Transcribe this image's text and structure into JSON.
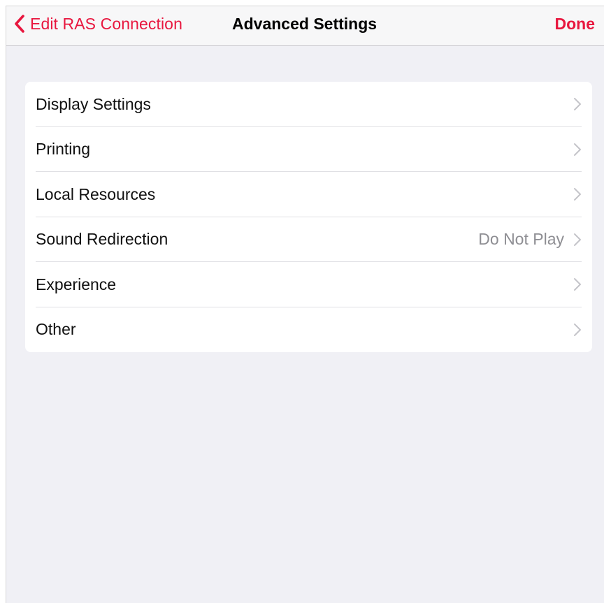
{
  "colors": {
    "accent": "#e8173f",
    "chevron": "#c4c4c9",
    "detail": "#8e8e93"
  },
  "navbar": {
    "back_label": "Edit RAS Connection",
    "back_icon": "chevron-left-icon",
    "title": "Advanced Settings",
    "done_label": "Done"
  },
  "settings": {
    "items": [
      {
        "label": "Display Settings",
        "detail": "",
        "icon": "chevron-right-icon"
      },
      {
        "label": "Printing",
        "detail": "",
        "icon": "chevron-right-icon"
      },
      {
        "label": "Local Resources",
        "detail": "",
        "icon": "chevron-right-icon"
      },
      {
        "label": "Sound Redirection",
        "detail": "Do Not Play",
        "icon": "chevron-right-icon"
      },
      {
        "label": "Experience",
        "detail": "",
        "icon": "chevron-right-icon"
      },
      {
        "label": "Other",
        "detail": "",
        "icon": "chevron-right-icon"
      }
    ]
  }
}
